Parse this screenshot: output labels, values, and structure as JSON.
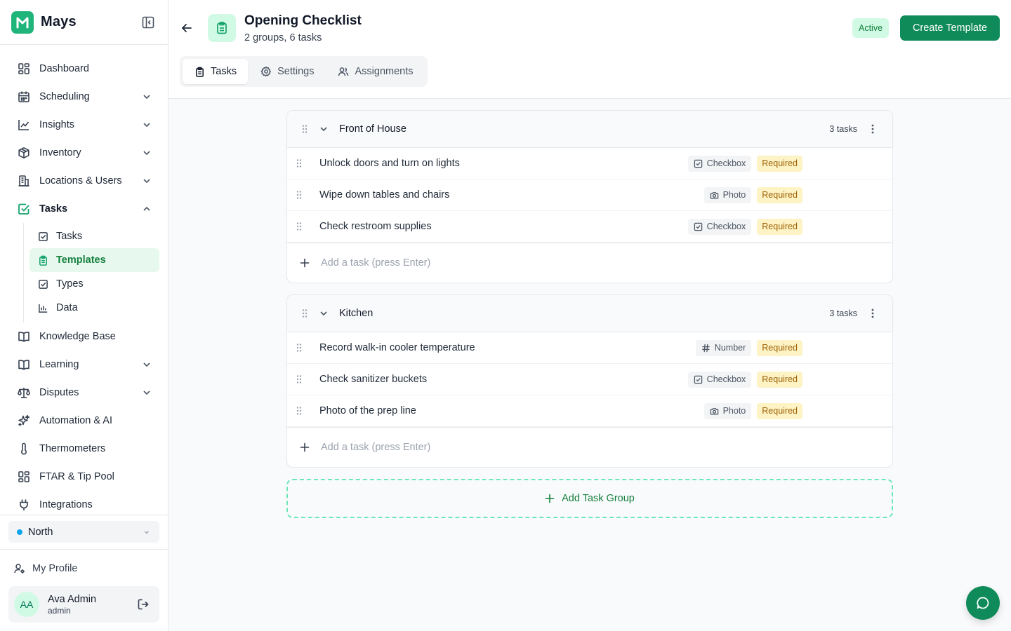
{
  "brand": {
    "name": "Mays"
  },
  "sidebar": {
    "items": [
      {
        "label": "Dashboard",
        "icon": "dashboard-icon"
      },
      {
        "label": "Scheduling",
        "icon": "calendar-icon"
      },
      {
        "label": "Insights",
        "icon": "chart-line-icon"
      },
      {
        "label": "Inventory",
        "icon": "box-icon"
      },
      {
        "label": "Locations & Users",
        "icon": "building-icon"
      },
      {
        "label": "Tasks",
        "icon": "check-square-icon"
      },
      {
        "label": "Knowledge Base",
        "icon": "book-open-icon"
      },
      {
        "label": "Learning",
        "icon": "book-icon"
      },
      {
        "label": "Disputes",
        "icon": "scale-icon"
      },
      {
        "label": "Automation & AI",
        "icon": "sparkles-icon"
      },
      {
        "label": "Thermometers",
        "icon": "thermometer-icon"
      },
      {
        "label": "FTAR & Tip Pool",
        "icon": "grid-icon"
      },
      {
        "label": "Integrations",
        "icon": "plug-icon"
      }
    ],
    "tasks_sub": [
      {
        "label": "Tasks"
      },
      {
        "label": "Templates"
      },
      {
        "label": "Types"
      },
      {
        "label": "Data"
      }
    ],
    "location": {
      "label": "North",
      "dot_color": "#0ea5e9"
    },
    "profile_link": "My Profile",
    "user": {
      "initials": "AA",
      "name": "Ava Admin",
      "role": "admin"
    }
  },
  "header": {
    "title": "Opening Checklist",
    "subtitle": "2 groups, 6 tasks",
    "status": "Active",
    "create_button": "Create Template",
    "tabs": [
      {
        "label": "Tasks",
        "active": true
      },
      {
        "label": "Settings",
        "active": false
      },
      {
        "label": "Assignments",
        "active": false
      }
    ]
  },
  "groups": [
    {
      "title": "Front of House",
      "count": "3 tasks",
      "tasks": [
        {
          "name": "Unlock doors and turn on lights",
          "type": "Checkbox",
          "required": "Required"
        },
        {
          "name": "Wipe down tables and chairs",
          "type": "Photo",
          "required": "Required"
        },
        {
          "name": "Check restroom supplies",
          "type": "Checkbox",
          "required": "Required"
        }
      ],
      "add_placeholder": "Add a task (press Enter)"
    },
    {
      "title": "Kitchen",
      "count": "3 tasks",
      "tasks": [
        {
          "name": "Record walk-in cooler temperature",
          "type": "Number",
          "required": "Required"
        },
        {
          "name": "Check sanitizer buckets",
          "type": "Checkbox",
          "required": "Required"
        },
        {
          "name": "Photo of the prep line",
          "type": "Photo",
          "required": "Required"
        }
      ],
      "add_placeholder": "Add a task (press Enter)"
    }
  ],
  "add_group_label": "Add Task Group",
  "colors": {
    "accent": "#0f8a59",
    "brand": "#1fb47a",
    "required_bg": "#fdf3c4",
    "required_text": "#a16207"
  }
}
